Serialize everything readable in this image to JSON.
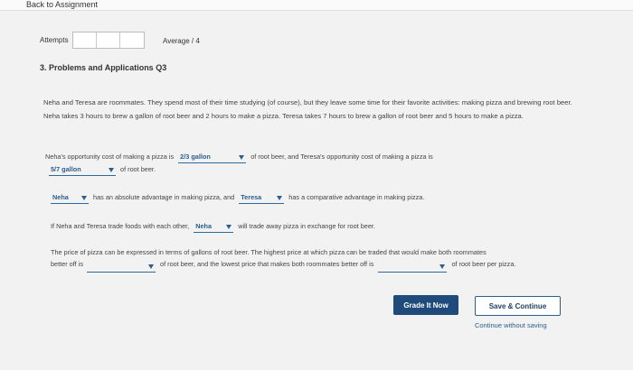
{
  "header": {
    "back_link": "Back to Assignment"
  },
  "attempts": {
    "label": "Attempts",
    "average": "Average / 4"
  },
  "question": {
    "title": "3. Problems and Applications Q3",
    "intro": "Neha and Teresa are roommates. They spend most of their time studying (of course), but they leave some time for their favorite activities: making pizza and brewing root beer. Neha takes 3 hours to brew a gallon of root beer and 2 hours to make a pizza. Teresa takes 7 hours to brew a gallon of root beer and 5 hours to make a pizza."
  },
  "part1": {
    "pre": "Neha's opportunity cost of making a pizza is",
    "dd1": "2/3 gallon",
    "mid": "of root beer, and Teresa's opportunity cost of making a pizza is",
    "dd2": "5/7 gallon",
    "post": "of root beer."
  },
  "part2": {
    "dd1": "Neha",
    "mid": "has an absolute advantage in making pizza, and",
    "dd2": "Teresa",
    "post": "has a comparative advantage in making pizza."
  },
  "part3": {
    "pre": "If Neha and Teresa trade foods with each other,",
    "dd1": "Neha",
    "post": "will trade away pizza in exchange for root beer."
  },
  "part4": {
    "line1": "The price of pizza can be expressed in terms of gallons of root beer. The highest price at which pizza can be traded that would make both roommates",
    "pre": "better off is",
    "mid": "of root beer, and the lowest price that makes both roommates better off is",
    "post": "of root beer per pizza."
  },
  "actions": {
    "grade": "Grade It Now",
    "save": "Save & Continue",
    "continue": "Continue without saving"
  }
}
